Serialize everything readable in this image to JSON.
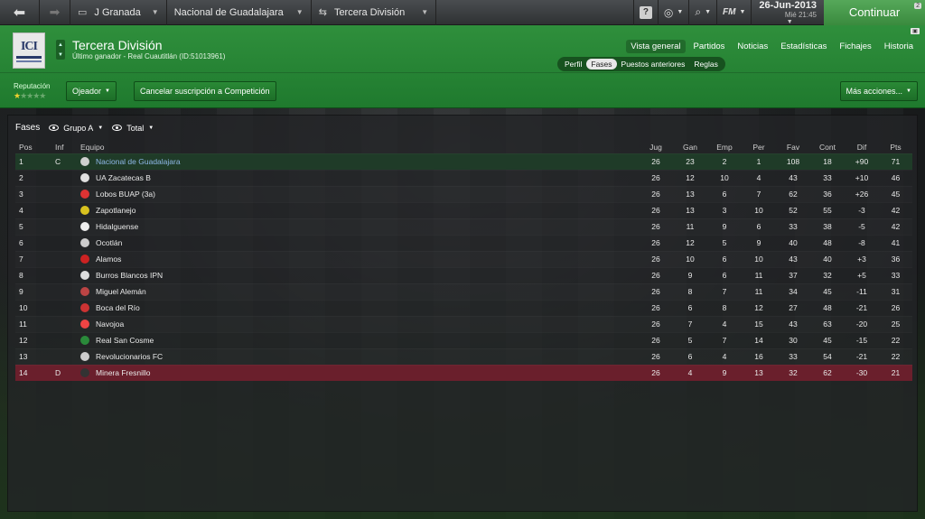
{
  "topbar": {
    "crumbs": [
      {
        "label": "J Granada"
      },
      {
        "label": "Nacional de Guadalajara"
      },
      {
        "label": "Tercera División"
      }
    ],
    "fm_label": "FM",
    "date": "26-Jun-2013",
    "day_time": "Mié 21:45",
    "continue_label": "Continuar",
    "continue_badge": "2"
  },
  "header": {
    "logo_text": "ICI",
    "title": "Tercera División",
    "subtitle": "Último ganador - Real Cuautitlán (ID:51013961)",
    "main_nav": [
      "Vista general",
      "Partidos",
      "Noticias",
      "Estadísticas",
      "Fichajes",
      "Historia"
    ],
    "sub_nav": [
      "Perfil",
      "Fases",
      "Puestos anteriores",
      "Reglas"
    ],
    "reputation_label": "Reputación",
    "scout_label": "Ojeador",
    "cancel_label": "Cancelar suscripción a Competición",
    "more_label": "Más acciones..."
  },
  "panel": {
    "title": "Fases",
    "group_label": "Grupo A",
    "total_label": "Total"
  },
  "table": {
    "columns": [
      "Pos",
      "Inf",
      "Equipo",
      "Jug",
      "Gan",
      "Emp",
      "Per",
      "Fav",
      "Cont",
      "Dif",
      "Pts"
    ],
    "rows": [
      {
        "pos": "1",
        "inf": "C",
        "team": "Nacional de Guadalajara",
        "jug": "26",
        "gan": "23",
        "emp": "2",
        "per": "1",
        "fav": "108",
        "cont": "18",
        "dif": "+90",
        "pts": "71"
      },
      {
        "pos": "2",
        "inf": "",
        "team": "UA Zacatecas B",
        "jug": "26",
        "gan": "12",
        "emp": "10",
        "per": "4",
        "fav": "43",
        "cont": "33",
        "dif": "+10",
        "pts": "46"
      },
      {
        "pos": "3",
        "inf": "",
        "team": "Lobos BUAP (3a)",
        "jug": "26",
        "gan": "13",
        "emp": "6",
        "per": "7",
        "fav": "62",
        "cont": "36",
        "dif": "+26",
        "pts": "45"
      },
      {
        "pos": "4",
        "inf": "",
        "team": "Zapotlanejo",
        "jug": "26",
        "gan": "13",
        "emp": "3",
        "per": "10",
        "fav": "52",
        "cont": "55",
        "dif": "-3",
        "pts": "42"
      },
      {
        "pos": "5",
        "inf": "",
        "team": "Hidalguense",
        "jug": "26",
        "gan": "11",
        "emp": "9",
        "per": "6",
        "fav": "33",
        "cont": "38",
        "dif": "-5",
        "pts": "42"
      },
      {
        "pos": "6",
        "inf": "",
        "team": "Ocotlán",
        "jug": "26",
        "gan": "12",
        "emp": "5",
        "per": "9",
        "fav": "40",
        "cont": "48",
        "dif": "-8",
        "pts": "41"
      },
      {
        "pos": "7",
        "inf": "",
        "team": "Alamos",
        "jug": "26",
        "gan": "10",
        "emp": "6",
        "per": "10",
        "fav": "43",
        "cont": "40",
        "dif": "+3",
        "pts": "36"
      },
      {
        "pos": "8",
        "inf": "",
        "team": "Burros Blancos IPN",
        "jug": "26",
        "gan": "9",
        "emp": "6",
        "per": "11",
        "fav": "37",
        "cont": "32",
        "dif": "+5",
        "pts": "33"
      },
      {
        "pos": "9",
        "inf": "",
        "team": "Miguel Alemán",
        "jug": "26",
        "gan": "8",
        "emp": "7",
        "per": "11",
        "fav": "34",
        "cont": "45",
        "dif": "-11",
        "pts": "31"
      },
      {
        "pos": "10",
        "inf": "",
        "team": "Boca del Río",
        "jug": "26",
        "gan": "6",
        "emp": "8",
        "per": "12",
        "fav": "27",
        "cont": "48",
        "dif": "-21",
        "pts": "26"
      },
      {
        "pos": "11",
        "inf": "",
        "team": "Navojoa",
        "jug": "26",
        "gan": "7",
        "emp": "4",
        "per": "15",
        "fav": "43",
        "cont": "63",
        "dif": "-20",
        "pts": "25"
      },
      {
        "pos": "12",
        "inf": "",
        "team": "Real San Cosme",
        "jug": "26",
        "gan": "5",
        "emp": "7",
        "per": "14",
        "fav": "30",
        "cont": "45",
        "dif": "-15",
        "pts": "22"
      },
      {
        "pos": "13",
        "inf": "",
        "team": "Revolucionarios FC",
        "jug": "26",
        "gan": "6",
        "emp": "4",
        "per": "16",
        "fav": "33",
        "cont": "54",
        "dif": "-21",
        "pts": "22"
      },
      {
        "pos": "14",
        "inf": "D",
        "team": "Minera Fresnillo",
        "jug": "26",
        "gan": "4",
        "emp": "9",
        "per": "13",
        "fav": "32",
        "cont": "62",
        "dif": "-30",
        "pts": "21"
      }
    ],
    "crest_colors": [
      "#cfcfcf",
      "#e0e0e0",
      "#d33",
      "#d8c21f",
      "#eee",
      "#ccc",
      "#c22",
      "#ddd",
      "#b44",
      "#c33",
      "#e44",
      "#2a8a3a",
      "#ccc",
      "#333"
    ]
  },
  "colors": {
    "header_green": "#2f8f3c",
    "continue_green": "#4c9e50",
    "highlight_row": "#1f3b28",
    "relegation_row": "#6a1f2c",
    "link_blue": "#8fb8e8"
  },
  "icons": [
    "back-arrow-icon",
    "forward-arrow-icon",
    "stadium-icon",
    "transfer-arrows-icon",
    "help-icon",
    "globe-icon",
    "search-icon",
    "eye-icon"
  ]
}
